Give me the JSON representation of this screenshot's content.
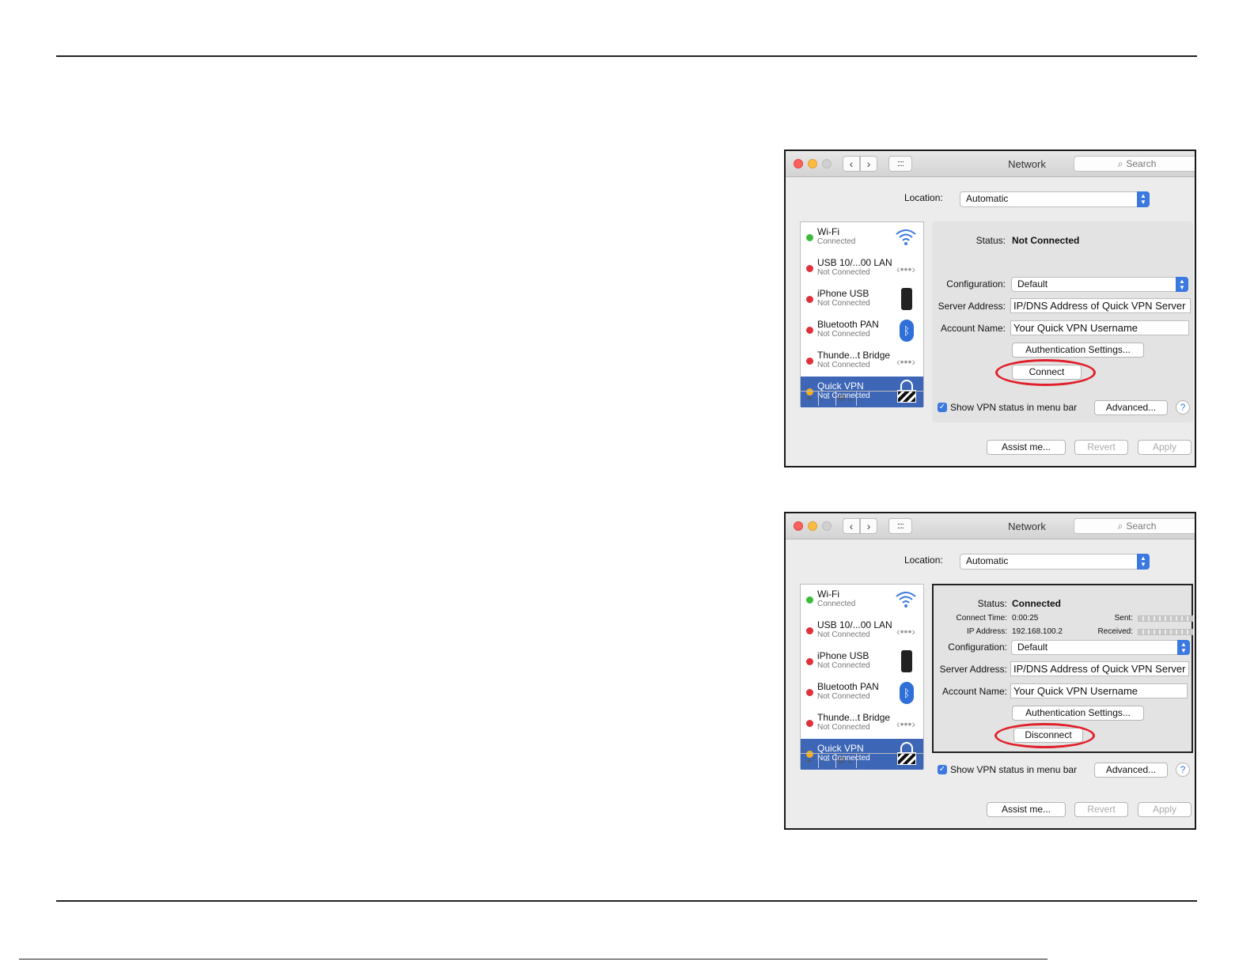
{
  "windows": [
    {
      "title": "Network",
      "search_placeholder": "Search",
      "location_label": "Location:",
      "location_value": "Automatic",
      "services": [
        {
          "name": "Wi-Fi",
          "status": "Connected",
          "dot": "green",
          "icon": "wifi-icon"
        },
        {
          "name": "USB 10/...00 LAN",
          "status": "Not Connected",
          "dot": "red",
          "icon": "ethernet-icon"
        },
        {
          "name": "iPhone USB",
          "status": "Not Connected",
          "dot": "red",
          "icon": "iphone-icon"
        },
        {
          "name": "Bluetooth PAN",
          "status": "Not Connected",
          "dot": "red",
          "icon": "bluetooth-icon"
        },
        {
          "name": "Thunde...t Bridge",
          "status": "Not Connected",
          "dot": "red",
          "icon": "ethernet-icon"
        },
        {
          "name": "Quick VPN",
          "status": "Not Connected",
          "dot": "yellow",
          "icon": "vpn-lock-icon"
        }
      ],
      "status_label": "Status:",
      "status_value": "Not Connected",
      "config_label": "Configuration:",
      "config_value": "Default",
      "server_label": "Server Address:",
      "server_value": "IP/DNS Address of Quick VPN Server",
      "account_label": "Account Name:",
      "account_value": "Your Quick VPN Username",
      "auth_button": "Authentication Settings...",
      "action_button": "Connect",
      "show_vpn_label": "Show VPN status in menu bar",
      "advanced_button": "Advanced...",
      "help_button": "?",
      "assist_button": "Assist me...",
      "revert_button": "Revert",
      "apply_button": "Apply"
    },
    {
      "title": "Network",
      "search_placeholder": "Search",
      "location_label": "Location:",
      "location_value": "Automatic",
      "services": [
        {
          "name": "Wi-Fi",
          "status": "Connected",
          "dot": "green",
          "icon": "wifi-icon"
        },
        {
          "name": "USB 10/...00 LAN",
          "status": "Not Connected",
          "dot": "red",
          "icon": "ethernet-icon"
        },
        {
          "name": "iPhone USB",
          "status": "Not Connected",
          "dot": "red",
          "icon": "iphone-icon"
        },
        {
          "name": "Bluetooth PAN",
          "status": "Not Connected",
          "dot": "red",
          "icon": "bluetooth-icon"
        },
        {
          "name": "Thunde...t Bridge",
          "status": "Not Connected",
          "dot": "red",
          "icon": "ethernet-icon"
        },
        {
          "name": "Quick VPN",
          "status": "Not Connected",
          "dot": "yellow",
          "icon": "vpn-lock-icon"
        }
      ],
      "status_label": "Status:",
      "status_value": "Connected",
      "connect_time_label": "Connect Time:",
      "connect_time_value": "0:00:25",
      "ip_label": "IP Address:",
      "ip_value": "192.168.100.2",
      "sent_label": "Sent:",
      "received_label": "Received:",
      "config_label": "Configuration:",
      "config_value": "Default",
      "server_label": "Server Address:",
      "server_value": "IP/DNS Address of Quick VPN Server",
      "account_label": "Account Name:",
      "account_value": "Your Quick VPN Username",
      "auth_button": "Authentication Settings...",
      "action_button": "Disconnect",
      "show_vpn_label": "Show VPN status in menu bar",
      "advanced_button": "Advanced...",
      "help_button": "?",
      "assist_button": "Assist me...",
      "revert_button": "Revert",
      "apply_button": "Apply"
    }
  ],
  "colors": {
    "highlight": "#e0202a",
    "selection": "#3d66b7",
    "accent": "#3b78e0"
  }
}
